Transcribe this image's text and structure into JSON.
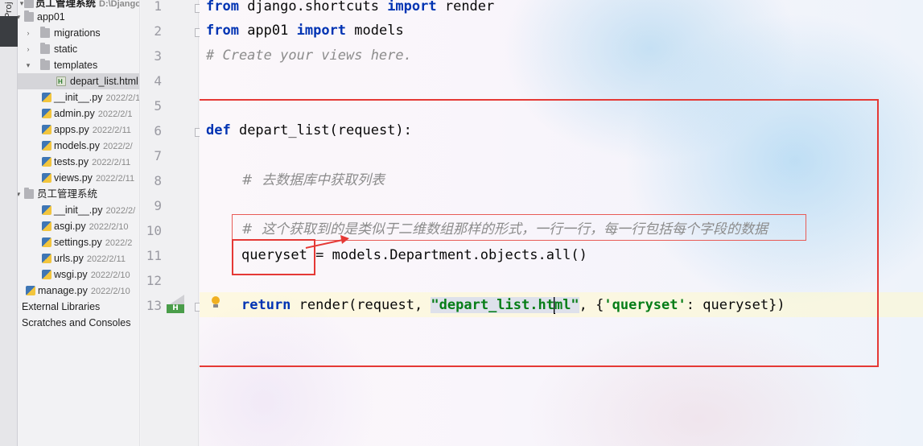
{
  "sidebar": {
    "tab_label": "Proj",
    "items": [
      {
        "label": "员工管理系统",
        "meta": "D:\\Django\\"
      },
      {
        "label": "app01",
        "meta": ""
      },
      {
        "label": "migrations",
        "meta": ""
      },
      {
        "label": "static",
        "meta": ""
      },
      {
        "label": "templates",
        "meta": ""
      },
      {
        "label": "depart_list.html",
        "meta": ""
      },
      {
        "label": "__init__.py",
        "meta": "2022/2/1"
      },
      {
        "label": "admin.py",
        "meta": "2022/2/1"
      },
      {
        "label": "apps.py",
        "meta": "2022/2/11"
      },
      {
        "label": "models.py",
        "meta": "2022/2/"
      },
      {
        "label": "tests.py",
        "meta": "2022/2/11"
      },
      {
        "label": "views.py",
        "meta": "2022/2/11"
      },
      {
        "label": "员工管理系统",
        "meta": ""
      },
      {
        "label": "__init__.py",
        "meta": "2022/2/"
      },
      {
        "label": "asgi.py",
        "meta": "2022/2/10"
      },
      {
        "label": "settings.py",
        "meta": "2022/2"
      },
      {
        "label": "urls.py",
        "meta": "2022/2/11"
      },
      {
        "label": "wsgi.py",
        "meta": "2022/2/10"
      },
      {
        "label": "manage.py",
        "meta": "2022/2/10"
      },
      {
        "label": "External Libraries",
        "meta": ""
      },
      {
        "label": "Scratches and Consoles",
        "meta": ""
      }
    ]
  },
  "gutter": {
    "line_numbers": [
      "1",
      "2",
      "3",
      "4",
      "5",
      "6",
      "7",
      "8",
      "9",
      "10",
      "11",
      "12",
      "13"
    ]
  },
  "editor": {
    "line1": {
      "kw1": "from",
      "mod": " django.shortcuts ",
      "kw2": "import",
      "name": " render"
    },
    "line2": {
      "kw1": "from",
      "mod": " app01 ",
      "kw2": "import",
      "name": " models"
    },
    "line3": {
      "comment": "# Create your views here."
    },
    "line6": {
      "kw": "def",
      "rest": " depart_list(request):"
    },
    "line8": {
      "comment": "#  去数据库中获取列表"
    },
    "line10": {
      "comment": "#  这个获取到的是类似于二维数组那样的形式，一行一行，每一行包括每个字段的数据"
    },
    "line11": {
      "text": "queryset = models.Department.objects.all()"
    },
    "line13": {
      "kw": "return",
      "part1": " render(request, ",
      "str_a": "\"depart_list.ht",
      "str_b": "ml\"",
      "part2": ", {",
      "str_key": "'queryset'",
      "part3": ": queryset})"
    }
  },
  "icons": {
    "folder": "folder-icon",
    "python_file": "python-file-icon",
    "html_file": "html-file-icon",
    "intention_bulb": "intention-bulb-icon",
    "run_html": "html-run-icon"
  },
  "colors": {
    "keyword": "#0033b3",
    "string": "#067d17",
    "comment": "#8c8c8c",
    "annotation_red": "#e53935"
  }
}
